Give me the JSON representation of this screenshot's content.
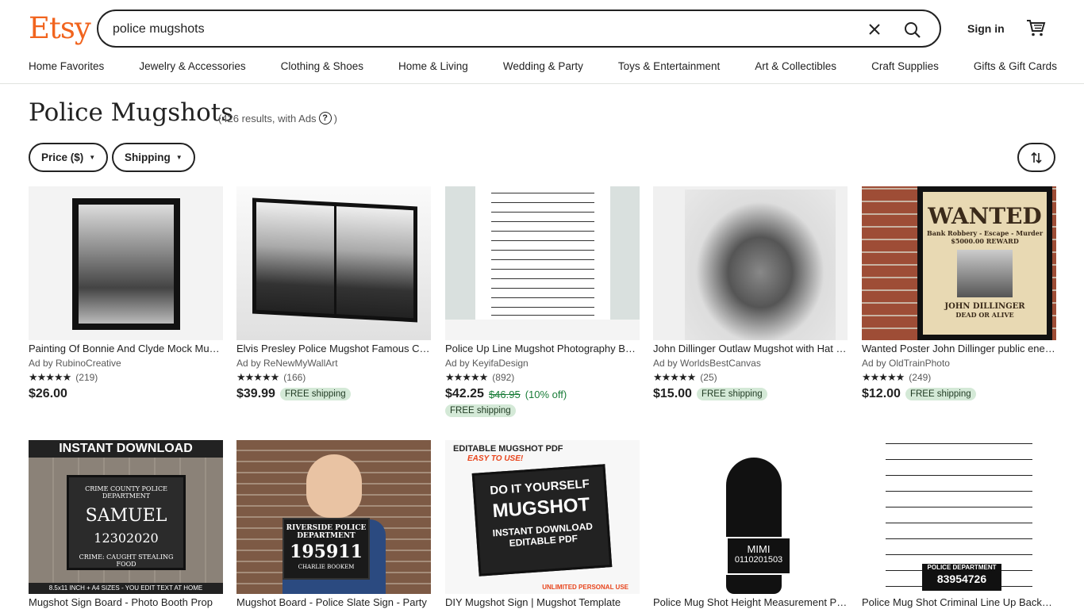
{
  "header": {
    "logo": "Etsy",
    "search_value": "police mugshots",
    "sign_in": "Sign in"
  },
  "nav": [
    "Home Favorites",
    "Jewelry & Accessories",
    "Clothing & Shoes",
    "Home & Living",
    "Wedding & Party",
    "Toys & Entertainment",
    "Art & Collectibles",
    "Craft Supplies",
    "Gifts & Gift Cards"
  ],
  "page": {
    "title": "Police Mugshots",
    "results": "(426 results, with Ads",
    "results_close": ")"
  },
  "filters": {
    "price": "Price ($)",
    "shipping": "Shipping"
  },
  "products": [
    {
      "title": "Painting Of Bonnie And Clyde Mock Mugshot",
      "shop": "Ad by RubinoCreative",
      "stars": "★★★★★",
      "reviews": "(219)",
      "price": "$26.00",
      "old_price": "",
      "discount": "",
      "free": ""
    },
    {
      "title": "Elvis Presley Police Mugshot Famous Celebrity",
      "shop": "Ad by ReNewMyWallArt",
      "stars": "★★★★★",
      "reviews": "(166)",
      "price": "$39.99",
      "old_price": "",
      "discount": "",
      "free": "FREE shipping"
    },
    {
      "title": "Police Up Line Mugshot Photography Backdrop",
      "shop": "Ad by KeyifaDesign",
      "stars": "★★★★★",
      "reviews": "(892)",
      "price": "$42.25",
      "old_price": "$46.95",
      "discount": "(10% off)",
      "free": "FREE shipping"
    },
    {
      "title": "John Dillinger Outlaw Mugshot with Hat Canvas",
      "shop": "Ad by WorldsBestCanvas",
      "stars": "★★★★★",
      "reviews": "(25)",
      "price": "$15.00",
      "old_price": "",
      "discount": "",
      "free": "FREE shipping"
    },
    {
      "title": "Wanted Poster John Dillinger public enemy",
      "shop": "Ad by OldTrainPhoto",
      "stars": "★★★★★",
      "reviews": "(249)",
      "price": "$12.00",
      "old_price": "",
      "discount": "",
      "free": "FREE shipping"
    },
    {
      "title": "Mugshot Sign Board - Photo Booth Prop"
    },
    {
      "title": "Mugshot Board - Police Slate Sign - Party"
    },
    {
      "title": "DIY Mugshot Sign | Mugshot Template"
    },
    {
      "title": "Police Mug Shot Height Measurement Poster"
    },
    {
      "title": "Police Mug Shot Criminal Line Up Backdrop"
    }
  ],
  "thumb_text": {
    "wanted": "WANTED",
    "wanted_sub": "Bank Robbery - Escape - Murder",
    "wanted_reward": "$5000.00 REWARD",
    "wanted_name": "JOHN DILLINGER",
    "wanted_dead": "DEAD OR ALIVE",
    "instant": "INSTANT DOWNLOAD",
    "crime_county": "CRIME COUNTY POLICE DEPARTMENT",
    "samuel": "SAMUEL",
    "samuel_num": "12302020",
    "samuel_crime": "CRIME: CAUGHT STEALING FOOD",
    "sizes": "8.5x11 INCH + A4 SIZES - YOU EDIT TEXT AT HOME",
    "riverside": "RIVERSIDE POLICE DEPARTMENT",
    "riverside_num": "195911",
    "riverside_name": "CHARLIE BOOKEM",
    "diy_hdr": "EDITABLE MUGSHOT PDF",
    "diy_sub": "EASY TO USE!",
    "diy_a": "DO IT YOURSELF",
    "diy_b": "MUGSHOT",
    "diy_c": "INSTANT DOWNLOAD EDITABLE PDF",
    "diy_ft": "UNLIMITED PERSONAL USE",
    "mimi": "MIMI",
    "mimi_num": "0110201503",
    "pd": "POLICE DEPARTMENT",
    "pd_num": "83954726"
  },
  "colors": {
    "brand": "#f1641e",
    "free_bg": "#d4e9d7",
    "sale": "#1a7d39"
  }
}
